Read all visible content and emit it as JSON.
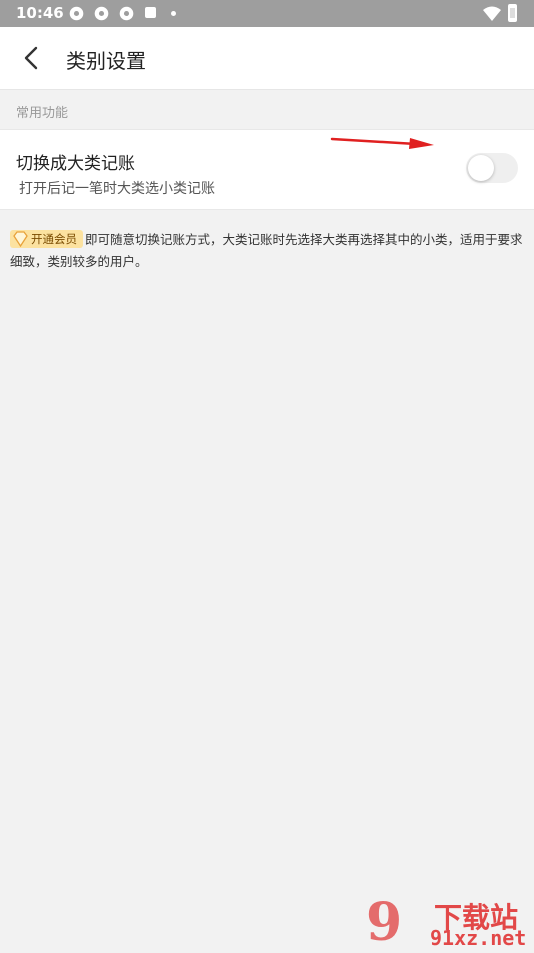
{
  "status": {
    "time": "10:46"
  },
  "header": {
    "title": "类别设置"
  },
  "section": {
    "label": "常用功能"
  },
  "option": {
    "title": "切换成大类记账",
    "description": "打开后记一笔时大类选小类记账",
    "toggle_on": false
  },
  "notice": {
    "badge": "开通会员",
    "text": "即可随意切换记账方式，大类记账时先选择大类再选择其中的小类，适用于要求细致，类别较多的用户。"
  },
  "watermark": {
    "top": "下载站",
    "bottom": "91xz.net"
  },
  "colors": {
    "statusbar": "#9e9e9e",
    "badge_bg": "#fce2a0",
    "arrow": "#e02020",
    "watermark": "#e24848"
  },
  "icons": [
    "back-arrow-icon",
    "gear-icon",
    "square-icon",
    "wifi-icon",
    "battery-icon",
    "diamond-icon"
  ]
}
